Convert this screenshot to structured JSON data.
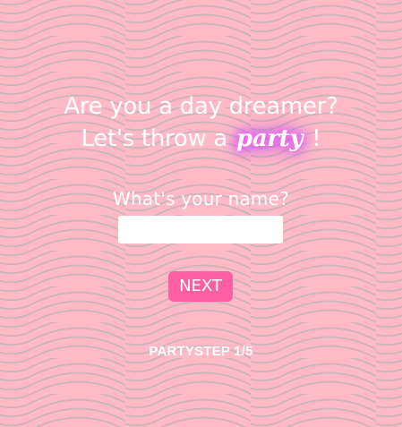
{
  "headline": {
    "line1": "Are you a day dreamer?",
    "line2_prefix": "Let's throw a ",
    "highlight_word": "party",
    "line2_suffix": " !"
  },
  "form": {
    "prompt": "What's your name?",
    "name_value": "",
    "name_placeholder": ""
  },
  "actions": {
    "next_label": "NEXT"
  },
  "progress": {
    "label": "PARTYSTEP 1/5"
  },
  "colors": {
    "background": "#ffbac6",
    "wave_stroke": "#c4b3b7",
    "button": "#ff5fa2",
    "text": "#ffffff",
    "glow": "#d34dff"
  }
}
